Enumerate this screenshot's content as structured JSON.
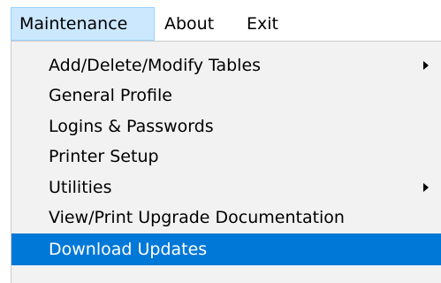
{
  "menubar": {
    "items": [
      {
        "label": "Maintenance"
      },
      {
        "label": "About"
      },
      {
        "label": "Exit"
      }
    ]
  },
  "dropdown": {
    "items": [
      {
        "label": "Add/Delete/Modify Tables",
        "has_submenu": true
      },
      {
        "label": "General Profile"
      },
      {
        "label": "Logins & Passwords"
      },
      {
        "label": "Printer Setup"
      },
      {
        "label": "Utilities",
        "has_submenu": true
      },
      {
        "label": "View/Print Upgrade Documentation"
      },
      {
        "label": "Download Updates",
        "highlighted": true
      }
    ]
  },
  "colors": {
    "active_menu_bg": "#cce8ff",
    "highlight_bg": "#0078d7",
    "dropdown_bg": "#f2f2f2"
  },
  "icons": {
    "submenu_arrow": "chevron-right-icon"
  }
}
